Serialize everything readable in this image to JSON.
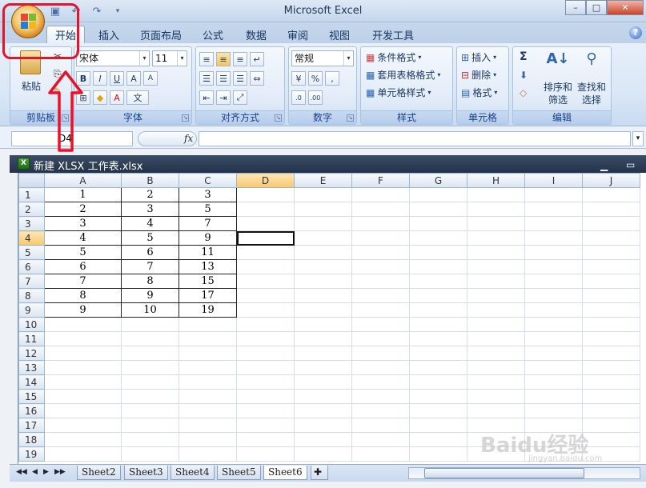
{
  "app": {
    "title": "Microsoft Excel"
  },
  "quick_access": {
    "save_icon": "save-icon",
    "undo_icon": "undo-icon",
    "redo_icon": "redo-icon"
  },
  "tabs": [
    {
      "label": "开始",
      "active": true
    },
    {
      "label": "插入"
    },
    {
      "label": "页面布局"
    },
    {
      "label": "公式"
    },
    {
      "label": "数据"
    },
    {
      "label": "审阅"
    },
    {
      "label": "视图"
    },
    {
      "label": "开发工具"
    }
  ],
  "ribbon": {
    "clipboard": {
      "label": "剪贴板",
      "paste": "粘贴"
    },
    "font": {
      "label": "字体",
      "name": "宋体",
      "size": "11"
    },
    "alignment": {
      "label": "对齐方式"
    },
    "number": {
      "label": "数字",
      "format": "常规"
    },
    "styles": {
      "label": "样式",
      "conditional": "条件格式",
      "table": "套用表格格式",
      "cell": "单元格样式"
    },
    "cells": {
      "label": "单元格",
      "insert": "插入",
      "delete": "删除",
      "format": "格式"
    },
    "editing": {
      "label": "编辑",
      "sort": "排序和",
      "sort2": "筛选",
      "find": "查找和",
      "find2": "选择"
    }
  },
  "formula_bar": {
    "name_box": "D4",
    "fx": "fx",
    "value": ""
  },
  "workbook": {
    "title": "新建 XLSX 工作表.xlsx"
  },
  "sheet": {
    "columns": [
      "A",
      "B",
      "C",
      "D",
      "E",
      "F",
      "G",
      "H",
      "I",
      "J"
    ],
    "rows": [
      [
        "1",
        "2",
        "3"
      ],
      [
        "2",
        "3",
        "5"
      ],
      [
        "3",
        "4",
        "7"
      ],
      [
        "4",
        "5",
        "9"
      ],
      [
        "5",
        "6",
        "11"
      ],
      [
        "6",
        "7",
        "13"
      ],
      [
        "7",
        "8",
        "15"
      ],
      [
        "8",
        "9",
        "17"
      ],
      [
        "9",
        "10",
        "19"
      ]
    ],
    "row_count": 19,
    "active_cell": "D4"
  },
  "sheet_tabs": [
    {
      "label": "Sheet2"
    },
    {
      "label": "Sheet3"
    },
    {
      "label": "Sheet4"
    },
    {
      "label": "Sheet5"
    },
    {
      "label": "Sheet6",
      "active": true
    }
  ],
  "watermark": {
    "text": "Baidu经验",
    "sub": "jingyan.baidu.com"
  },
  "colors": {
    "highlight": "#e8122a",
    "accent": "#15428b"
  }
}
